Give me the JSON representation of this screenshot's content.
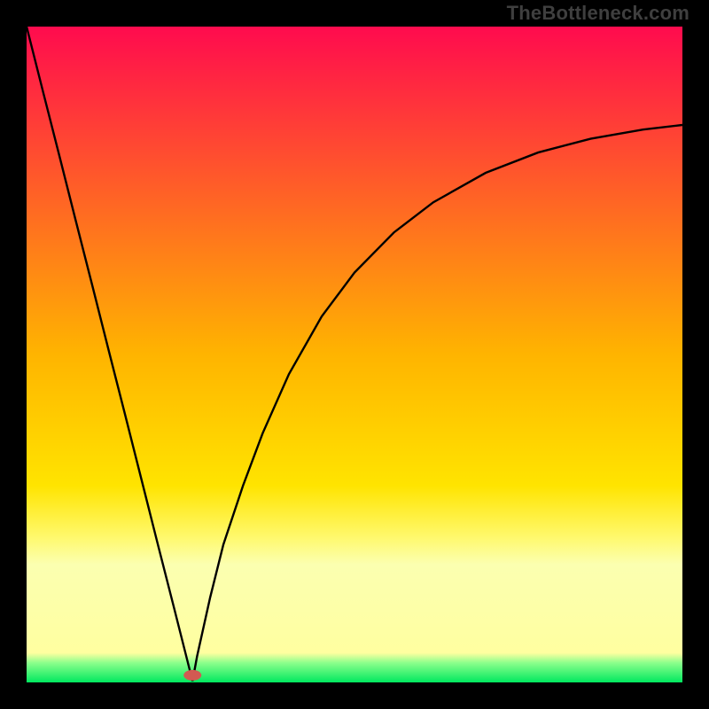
{
  "watermark": "TheBottleneck.com",
  "chart_data": {
    "type": "line",
    "title": "",
    "xlabel": "",
    "ylabel": "",
    "xlim": [
      0,
      1
    ],
    "ylim": [
      0,
      1
    ],
    "background_gradient": {
      "stops": [
        {
          "offset": 0.0,
          "color": "#ff0b4e"
        },
        {
          "offset": 0.5,
          "color": "#ffb400"
        },
        {
          "offset": 0.7,
          "color": "#ffe400"
        },
        {
          "offset": 0.78,
          "color": "#fff96f"
        },
        {
          "offset": 0.82,
          "color": "#fbffb0"
        },
        {
          "offset": 0.955,
          "color": "#ffffa0"
        },
        {
          "offset": 0.97,
          "color": "#8cff8c"
        },
        {
          "offset": 1.0,
          "color": "#00e85f"
        }
      ]
    },
    "minimum_marker": {
      "x": 0.253,
      "y": 0.989,
      "color": "#d25a52"
    },
    "series": [
      {
        "name": "left-branch",
        "x": [
          0.0,
          0.025,
          0.05,
          0.075,
          0.1,
          0.125,
          0.15,
          0.175,
          0.2,
          0.225,
          0.25,
          0.253
        ],
        "y": [
          0.0,
          0.099,
          0.197,
          0.296,
          0.394,
          0.493,
          0.591,
          0.69,
          0.789,
          0.887,
          0.986,
          0.998
        ]
      },
      {
        "name": "right-branch",
        "x": [
          0.253,
          0.26,
          0.28,
          0.3,
          0.33,
          0.36,
          0.4,
          0.45,
          0.5,
          0.56,
          0.62,
          0.7,
          0.78,
          0.86,
          0.94,
          1.0
        ],
        "y": [
          0.998,
          0.96,
          0.87,
          0.79,
          0.7,
          0.62,
          0.53,
          0.442,
          0.375,
          0.314,
          0.268,
          0.223,
          0.192,
          0.171,
          0.157,
          0.15
        ]
      }
    ]
  }
}
